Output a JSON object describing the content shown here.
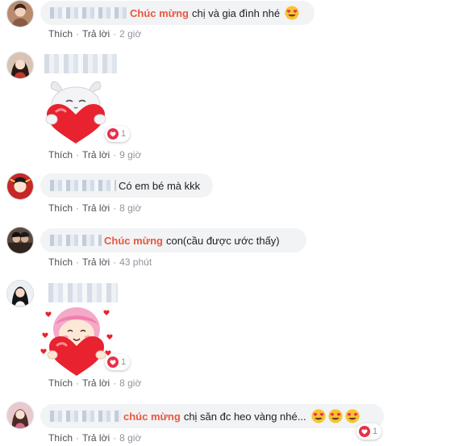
{
  "comments": [
    {
      "highlight": "Chúc mừng",
      "message": "chị và gia đình nhé",
      "emoji": "heart-eyes-emoji",
      "actions": {
        "like": "Thích",
        "reply": "Trả lời",
        "time": "2 giờ"
      }
    },
    {
      "sticker": "bunny-hugging-heart-sticker",
      "reaction_count": "1",
      "actions": {
        "like": "Thích",
        "reply": "Trả lời",
        "time": "9 giờ"
      }
    },
    {
      "message": "Có em bé mà kkk",
      "actions": {
        "like": "Thích",
        "reply": "Trả lời",
        "time": "8 giờ"
      }
    },
    {
      "highlight": "Chúc mừng",
      "message": "con(cầu được ước thấy)",
      "actions": {
        "like": "Thích",
        "reply": "Trả lời",
        "time": "43 phút"
      }
    },
    {
      "sticker": "girl-hugging-heart-sticker",
      "reaction_count": "1",
      "actions": {
        "like": "Thích",
        "reply": "Trả lời",
        "time": "8 giờ"
      }
    },
    {
      "highlight": "chúc mừng",
      "message": "chị săn đc heo vàng nhé...",
      "emoji": "heart-eyes-emoji",
      "reaction_count": "1",
      "actions": {
        "like": "Thích",
        "reply": "Trả lời",
        "time": "8 giờ"
      }
    }
  ],
  "colors": {
    "highlight": "#e9573f",
    "bubble": "#f2f3f5",
    "action_link": "#4b4f56",
    "muted": "#90949c",
    "reaction_heart": "#e8304a"
  }
}
